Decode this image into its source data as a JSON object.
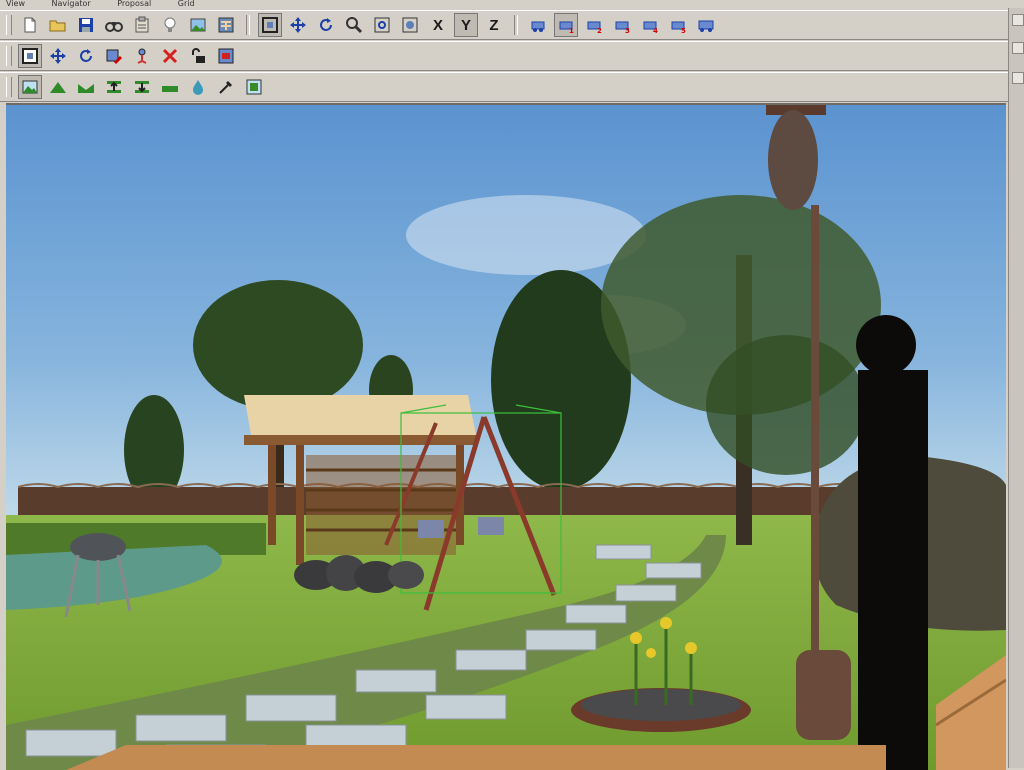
{
  "menu": {
    "items": [
      "View",
      "Navigator",
      "Proposal",
      "Grid"
    ]
  },
  "toolbar1": {
    "axis_x": "X",
    "axis_y": "Y",
    "axis_z": "Z"
  },
  "icons": {
    "row1": [
      "new-file-icon",
      "open-folder-icon",
      "save-icon",
      "binoculars-icon",
      "properties-icon",
      "light-bulb-icon",
      "picture-icon",
      "wallpaper-icon",
      "select-frame-icon",
      "move-icon",
      "rotate-icon",
      "zoom-icon",
      "fit-view-icon",
      "fit-all-icon",
      "view-1-icon",
      "view-2-icon",
      "view-3-icon",
      "view-4-icon",
      "view-5-icon",
      "view-6-icon",
      "view-7-icon"
    ],
    "row2": [
      "select-object-icon",
      "move-object-icon",
      "rotate-object-icon",
      "edit-object-icon",
      "walk-icon",
      "delete-icon",
      "lock-icon",
      "render-icon"
    ],
    "row3": [
      "terrain-icon",
      "hill-icon",
      "valley-icon",
      "slope-up-icon",
      "slope-down-icon",
      "flatten-icon",
      "water-drop-icon",
      "eyedropper-icon",
      "texture-icon"
    ]
  },
  "colors": {
    "sky_top": "#5d95d2",
    "sky_bottom": "#b6d4ea",
    "grass": "#7fae3a",
    "accent_blue": "#1c3fa8",
    "delete_red": "#d4201c"
  }
}
